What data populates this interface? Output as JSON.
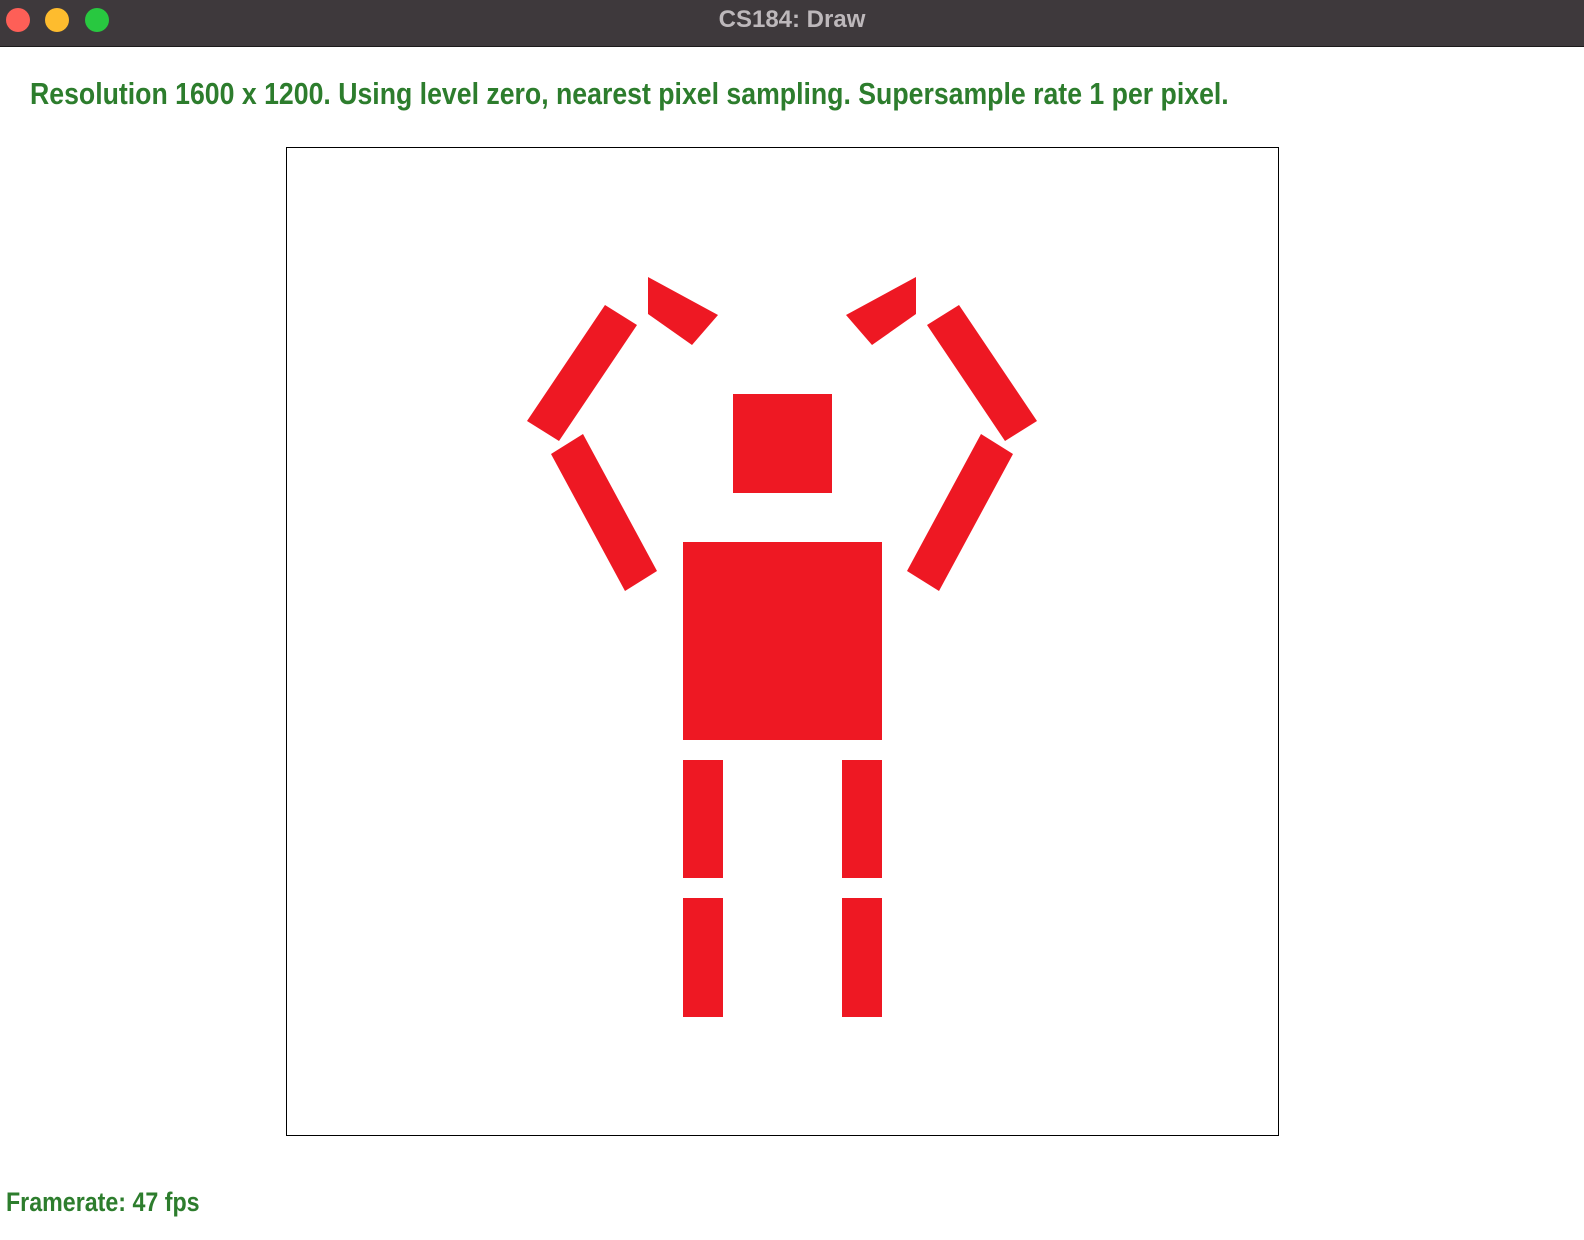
{
  "window": {
    "title": "CS184: Draw",
    "controls": [
      "close-icon",
      "minimize-icon",
      "zoom-icon"
    ],
    "control_colors": {
      "close": "#fe5f57",
      "minimize": "#febc2e",
      "zoom": "#28c840"
    }
  },
  "status": {
    "text": "Resolution 1600 x 1200. Using level zero, nearest pixel sampling. Supersample rate 1 per pixel."
  },
  "footer": {
    "framerate": "Framerate: 47 fps"
  },
  "drawing": {
    "subject": "red-robot-figure",
    "fill_color": "#ee1823",
    "background": "#ffffff",
    "border": "#000000"
  }
}
